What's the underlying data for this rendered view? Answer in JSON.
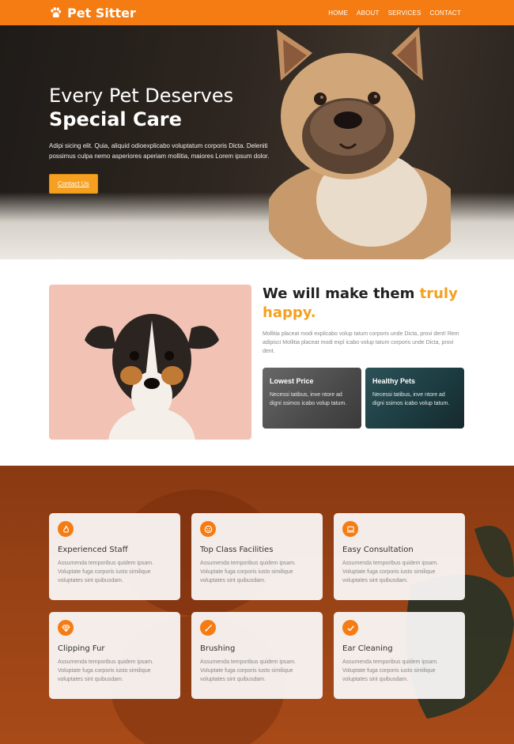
{
  "colors": {
    "accent": "#f57c12",
    "highlight": "#f5a020"
  },
  "nav": {
    "brand": "Pet Sitter",
    "brand_icon": "paw-icon",
    "links": [
      "HOME",
      "ABOUT",
      "SERVICES",
      "CONTACT"
    ]
  },
  "hero": {
    "title_line1": "Every Pet Deserves",
    "title_line2": "Special Care",
    "description": "Adipi sicing elit. Quia, aliquid odioexplicabo voluptatum corporis Dicta. Deleniti possimus culpa nemo asperiores aperiam mollitia, maiores Lorem ipsum dolor.",
    "button": "Contact Us"
  },
  "about": {
    "heading_plain": "We will make them",
    "heading_highlight": "truly happy.",
    "description": "Mollitia placeat modi explicabo volup tatum corporis unde Dicta, provi dent! Rem adipisci Mollitia placeat modi expl icabo volup tatum corporis unde Dicta, provi dent.",
    "cards": [
      {
        "title": "Lowest Price",
        "text": "Necessi tatibus, inve ntore ad digni ssimos icabo volup tatum."
      },
      {
        "title": "Healthy Pets",
        "text": "Necessi tatibus, inve ntore ad digni ssimos icabo volup tatum."
      }
    ]
  },
  "services": {
    "items": [
      {
        "icon": "fire-icon",
        "title": "Experienced Staff",
        "text": "Assumenda temporibus quidem ipsam. Voluptate fuga corporis iusto similique voluptates sint quibusdam."
      },
      {
        "icon": "smile-icon",
        "title": "Top Class Facilities",
        "text": "Assumenda temporibus quidem ipsam. Voluptate fuga corporis iusto similique voluptates sint quibusdam."
      },
      {
        "icon": "laptop-icon",
        "title": "Easy Consultation",
        "text": "Assumenda temporibus quidem ipsam. Voluptate fuga corporis iusto similique voluptates sint quibusdam."
      },
      {
        "icon": "diamond-icon",
        "title": "Clipping Fur",
        "text": "Assumenda temporibus quidem ipsam. Voluptate fuga corporis iusto similique voluptates sint quibusdam."
      },
      {
        "icon": "brush-icon",
        "title": "Brushing",
        "text": "Assumenda temporibus quidem ipsam. Voluptate fuga corporis iusto similique voluptates sint quibusdam."
      },
      {
        "icon": "check-icon",
        "title": "Ear Cleaning",
        "text": "Assumenda temporibus quidem ipsam. Voluptate fuga corporis iusto similique voluptates sint quibusdam."
      }
    ]
  }
}
